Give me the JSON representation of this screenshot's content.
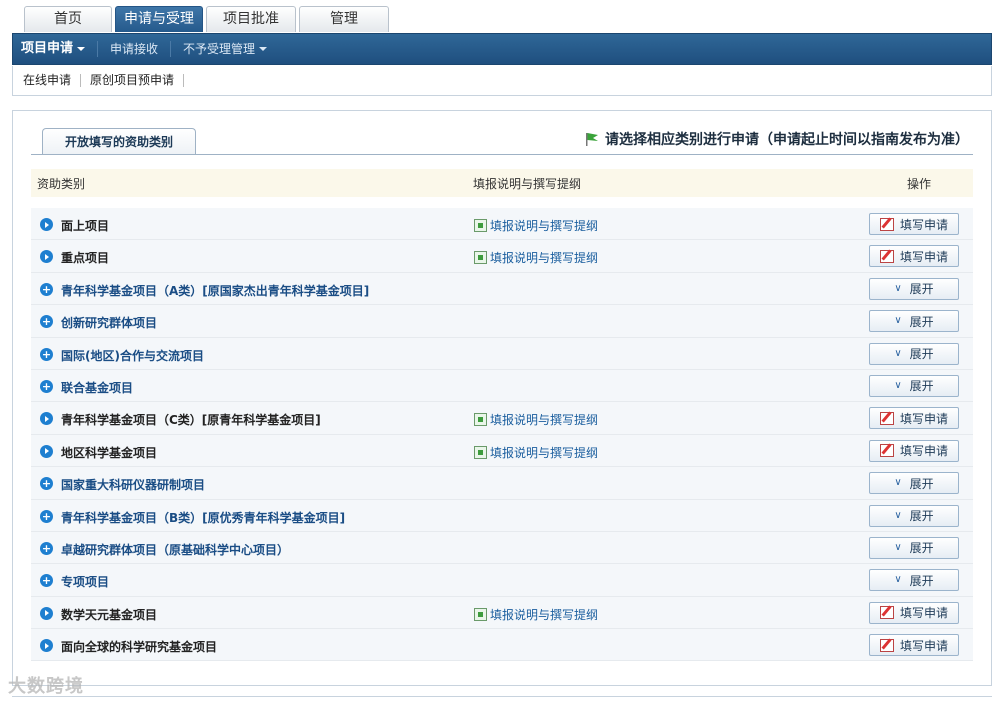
{
  "top_tabs": [
    "首页",
    "申请与受理",
    "项目批准",
    "管理"
  ],
  "nav": {
    "items": [
      "项目申请",
      "申请接收",
      "不予受理管理"
    ]
  },
  "sub_nav": [
    "在线申请",
    "原创项目预申请"
  ],
  "panel": {
    "tab_label": "开放填写的资助类别",
    "notice": "请选择相应类别进行申请（申请起止时间以指南发布为准）",
    "columns": [
      "资助类别",
      "填报说明与撰写提纲",
      "操作"
    ]
  },
  "rows": [
    {
      "name": "面上项目",
      "guide": "填报说明与撰写提纲",
      "action": "填写申请"
    },
    {
      "name": "重点项目",
      "guide": "填报说明与撰写提纲",
      "action": "填写申请"
    },
    {
      "name": "青年科学基金项目（A类）[原国家杰出青年科学基金项目]",
      "guide": "",
      "action": "展开"
    },
    {
      "name": "创新研究群体项目",
      "guide": "",
      "action": "展开"
    },
    {
      "name": "国际(地区)合作与交流项目",
      "guide": "",
      "action": "展开"
    },
    {
      "name": "联合基金项目",
      "guide": "",
      "action": "展开"
    },
    {
      "name": "青年科学基金项目（C类）[原青年科学基金项目]",
      "guide": "填报说明与撰写提纲",
      "action": "填写申请"
    },
    {
      "name": "地区科学基金项目",
      "guide": "填报说明与撰写提纲",
      "action": "填写申请"
    },
    {
      "name": "国家重大科研仪器研制项目",
      "guide": "",
      "action": "展开"
    },
    {
      "name": "青年科学基金项目（B类）[原优秀青年科学基金项目]",
      "guide": "",
      "action": "展开"
    },
    {
      "name": "卓越研究群体项目（原基础科学中心项目）",
      "guide": "",
      "action": "展开"
    },
    {
      "name": "专项项目",
      "guide": "",
      "action": "展开"
    },
    {
      "name": "数学天元基金项目",
      "guide": "填报说明与撰写提纲",
      "action": "填写申请"
    },
    {
      "name": "面向全球的科学研究基金项目",
      "guide": "",
      "action": "填写申请"
    }
  ],
  "watermark": "大数跨境"
}
